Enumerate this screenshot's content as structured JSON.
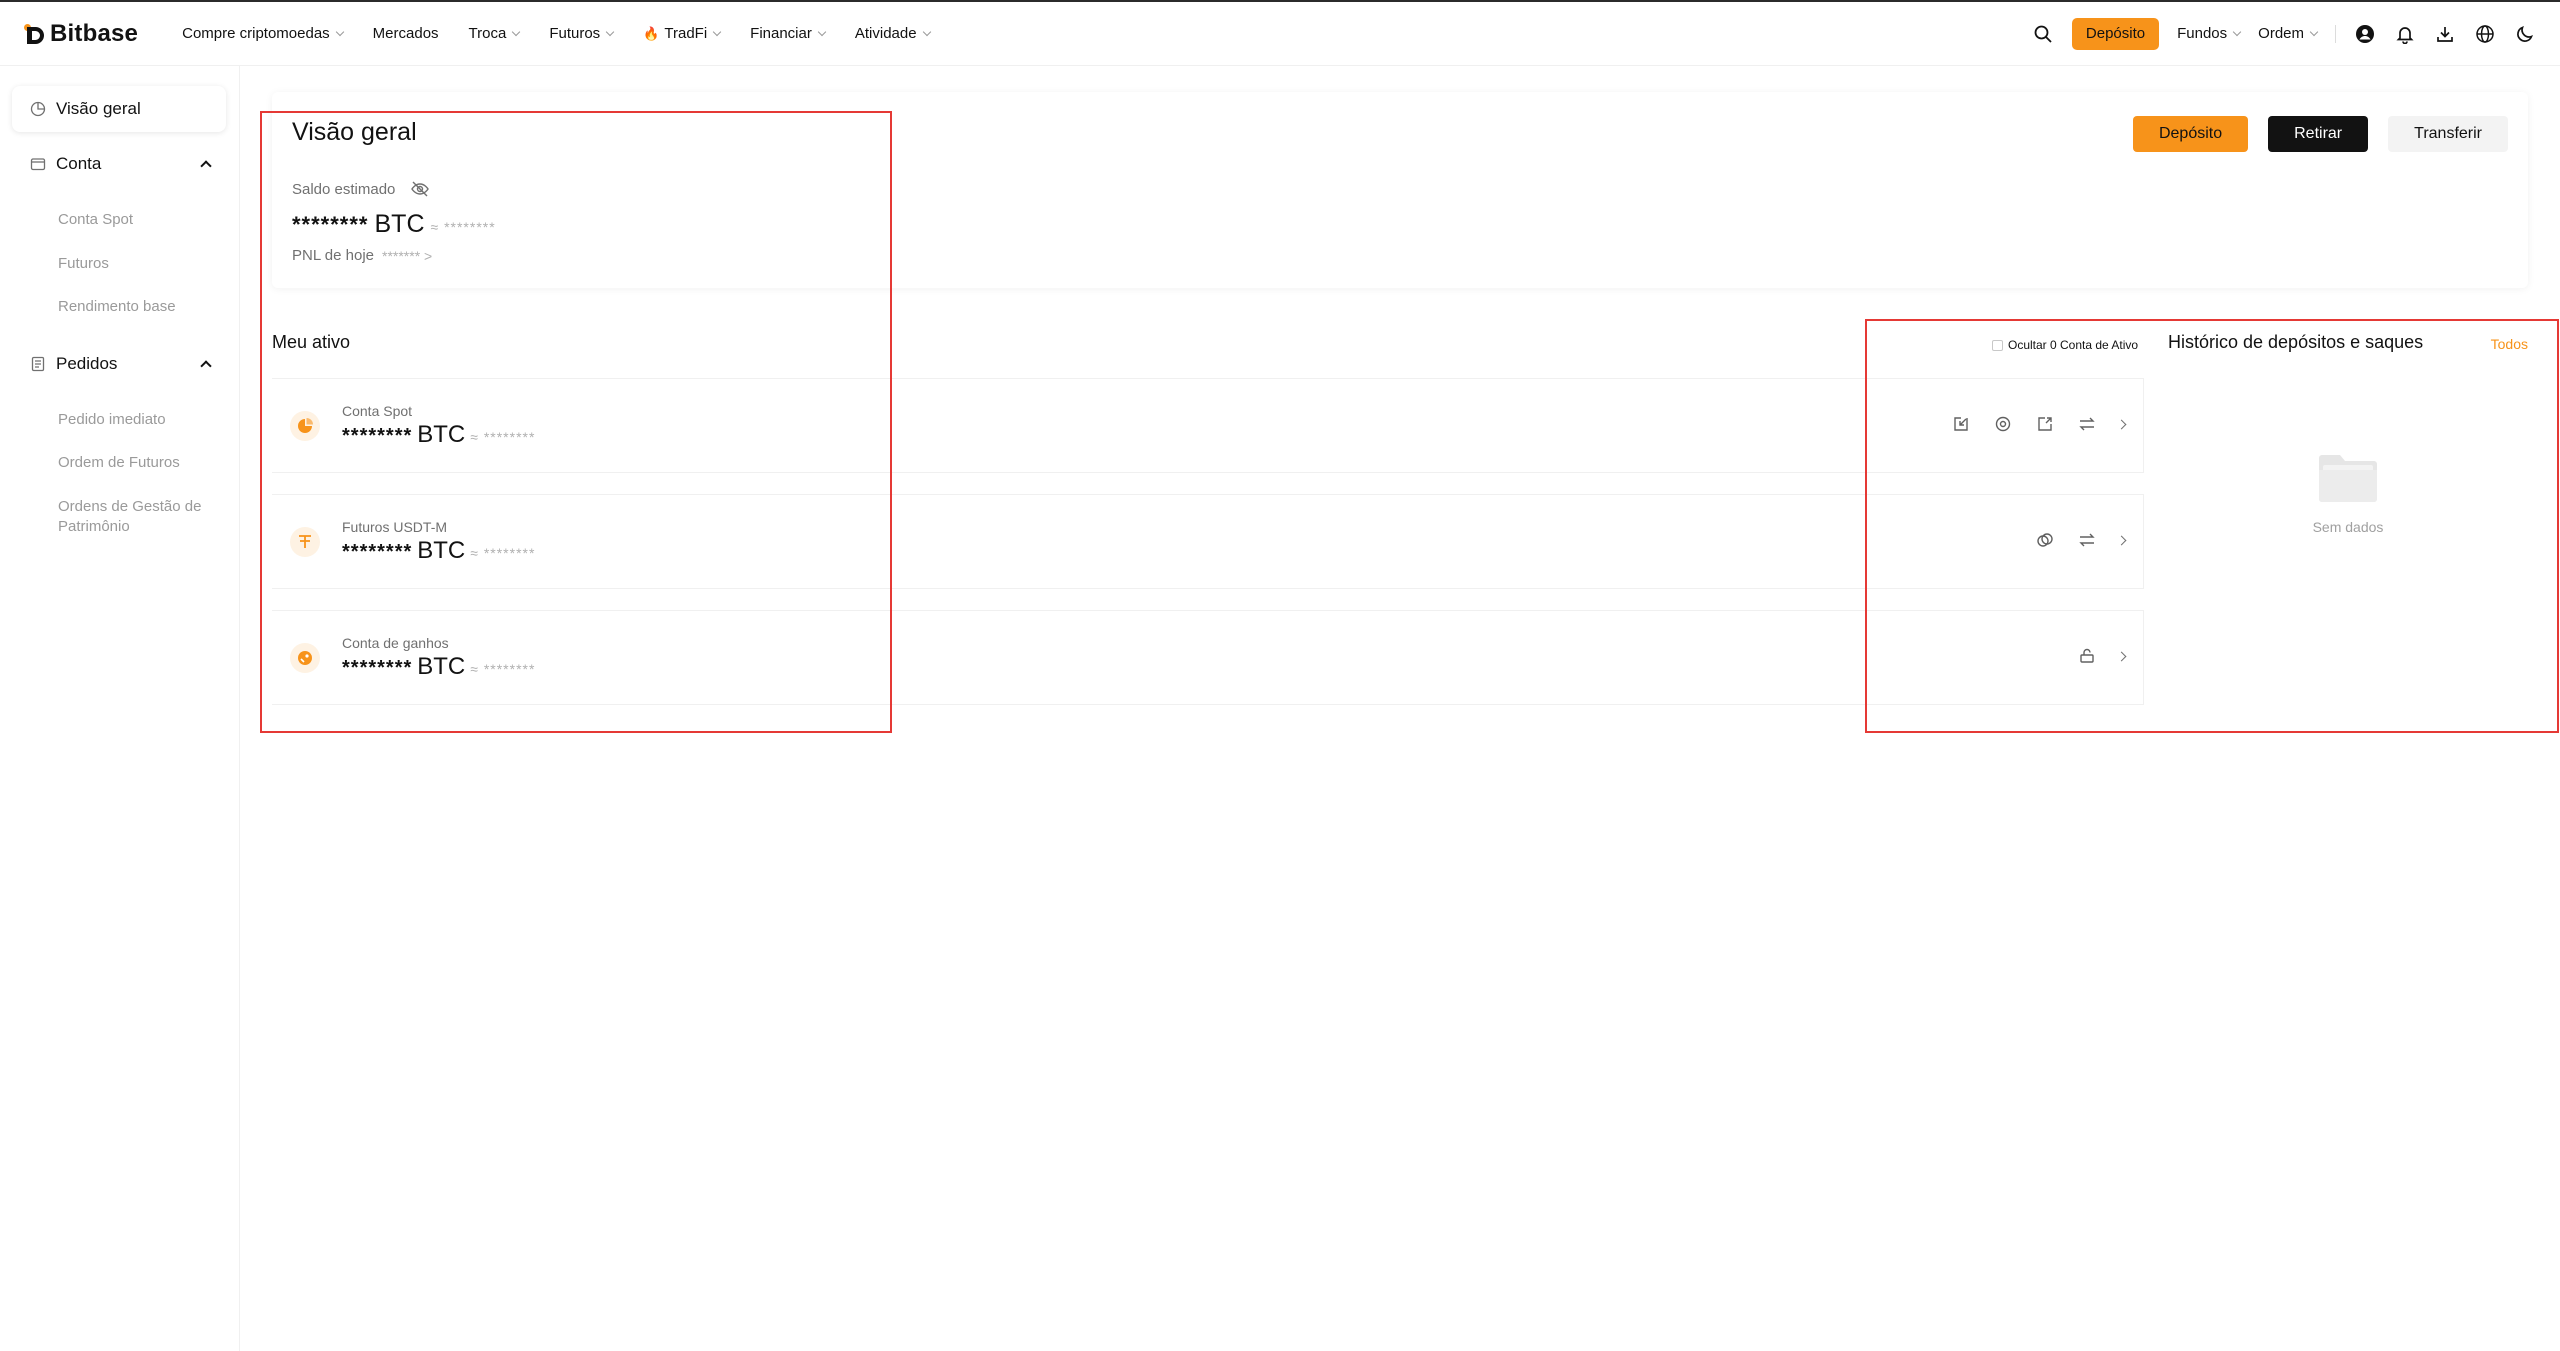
{
  "brand": {
    "name": "Bitbase"
  },
  "nav": {
    "items": [
      {
        "label": "Compre criptomoedas",
        "dropdown": true
      },
      {
        "label": "Mercados",
        "dropdown": false
      },
      {
        "label": "Troca",
        "dropdown": true
      },
      {
        "label": "Futuros",
        "dropdown": true
      },
      {
        "label": "TradFi",
        "dropdown": true,
        "hot": true
      },
      {
        "label": "Financiar",
        "dropdown": true
      },
      {
        "label": "Atividade",
        "dropdown": true
      }
    ],
    "deposit_label": "Depósito",
    "funds_label": "Fundos",
    "order_label": "Ordem",
    "icons": [
      "search-icon",
      "user-icon",
      "bell-icon",
      "download-icon",
      "globe-icon",
      "moon-icon"
    ]
  },
  "sidebar": {
    "active": "Visão geral",
    "groups": [
      {
        "label": "Conta",
        "items": [
          "Conta Spot",
          "Futuros",
          "Rendimento base"
        ]
      },
      {
        "label": "Pedidos",
        "items": [
          "Pedido imediato",
          "Ordem de Futuros",
          "Ordens de Gestão de Patrimônio"
        ]
      }
    ]
  },
  "overview": {
    "title": "Visão geral",
    "balance_label": "Saldo estimado",
    "balance_masked": "********",
    "currency": "BTC",
    "approx_masked": "≈ ********",
    "pnl_label": "PNL de hoje",
    "pnl_masked": "******* >",
    "actions": {
      "deposit": "Depósito",
      "withdraw": "Retirar",
      "transfer": "Transferir"
    }
  },
  "assets": {
    "title": "Meu ativo",
    "hide_zero_label": "Ocultar 0 Conta de Ativo",
    "rows": [
      {
        "name": "Conta Spot",
        "value": "********",
        "currency": "BTC",
        "approx": "≈ ********"
      },
      {
        "name": "Futuros USDT-M",
        "value": "********",
        "currency": "BTC",
        "approx": "≈ ********"
      },
      {
        "name": "Conta de ganhos",
        "value": "********",
        "currency": "BTC",
        "approx": "≈ ********"
      }
    ]
  },
  "history": {
    "title": "Histórico de depósitos e saques",
    "all_label": "Todos",
    "empty_label": "Sem dados"
  },
  "colors": {
    "accent": "#f7931a",
    "primary_dark": "#121212",
    "muted": "#707070",
    "annotation": "#e53935"
  }
}
